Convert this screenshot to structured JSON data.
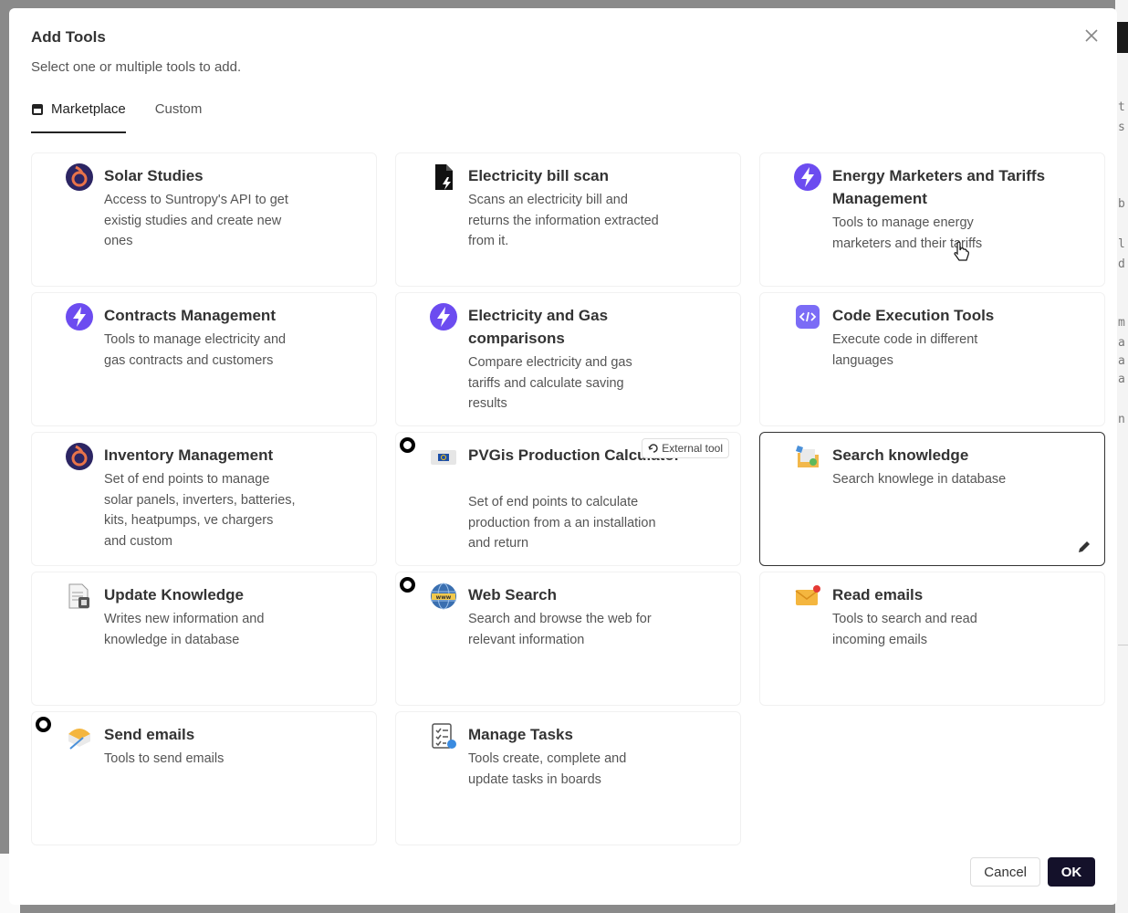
{
  "modal": {
    "title": "Add Tools",
    "subtitle": "Select one or multiple tools to add."
  },
  "tabs": [
    {
      "label": "Marketplace",
      "active": true,
      "icon": "store-icon"
    },
    {
      "label": "Custom",
      "active": false
    }
  ],
  "tools": [
    {
      "title": "Solar Studies",
      "description": "Access to Suntropy's API to get existig studies and create new ones",
      "icon": "suntropy-logo-icon"
    },
    {
      "title": "Electricity bill scan",
      "description": "Scans an electricity bill and returns the information extracted from it.",
      "icon": "bill-scan-icon"
    },
    {
      "title": "Energy Marketers and Tariffs Management",
      "description": "Tools to manage energy marketers and their tariffs",
      "icon": "lightning-icon"
    },
    {
      "title": "Contracts Management",
      "description": "Tools to manage electricity and gas contracts and customers",
      "icon": "lightning-icon"
    },
    {
      "title": "Electricity and Gas comparisons",
      "description": "Compare electricity and gas tariffs and calculate saving results",
      "icon": "lightning-icon"
    },
    {
      "title": "Code Execution Tools",
      "description": "Execute code in different languages",
      "icon": "code-icon"
    },
    {
      "title": "Inventory Management",
      "description": "Set of end points to manage solar panels, inverters, batteries, kits, heatpumps, ve chargers and custom",
      "icon": "suntropy-logo-icon"
    },
    {
      "title": "PVGis Production Calculator",
      "description": "Set of end points to calculate production from a an installation and return",
      "icon": "eu-flag-icon",
      "badge": "External tool"
    },
    {
      "title": "Search knowledge",
      "description": "Search knowlege in database",
      "icon": "folder-search-icon",
      "selected": true
    },
    {
      "title": "Update Knowledge",
      "description": "Writes new information and knowledge in database",
      "icon": "document-update-icon"
    },
    {
      "title": "Web Search",
      "description": "Search and browse the web for relevant information",
      "icon": "globe-www-icon"
    },
    {
      "title": "Read emails",
      "description": "Tools to search and read incoming emails",
      "icon": "envelope-icon"
    },
    {
      "title": "Send emails",
      "description": "Tools to send emails",
      "icon": "send-mail-icon"
    },
    {
      "title": "Manage Tasks",
      "description": "Tools create, complete and update tasks in boards",
      "icon": "task-list-icon"
    }
  ],
  "footer": {
    "cancel_label": "Cancel",
    "ok_label": "OK"
  },
  "colors": {
    "accent": "#14112a",
    "lightning": "#6c4cf0",
    "suntropy": "#2c2563",
    "suntropy_ring": "#e8734a"
  }
}
